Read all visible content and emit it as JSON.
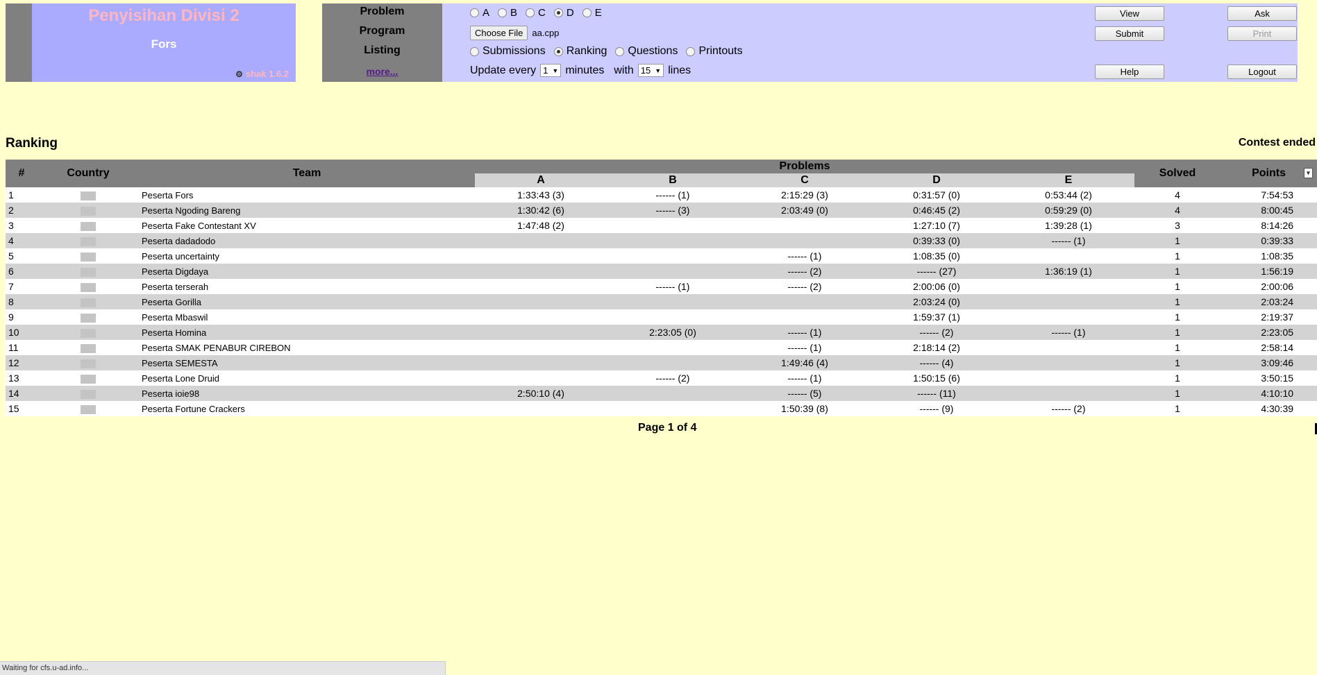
{
  "logo": {
    "title": "Penyisihan Divisi 2",
    "team": "Fors",
    "version_glyph": "⚙",
    "version": "shak 1.6.2"
  },
  "panel": {
    "labels": {
      "problem": "Problem",
      "program": "Program",
      "listing": "Listing",
      "more": "more..."
    },
    "problems": [
      {
        "label": "A",
        "selected": false
      },
      {
        "label": "B",
        "selected": false
      },
      {
        "label": "C",
        "selected": false
      },
      {
        "label": "D",
        "selected": true
      },
      {
        "label": "E",
        "selected": false
      }
    ],
    "choose_file": "Choose File",
    "file_name": "aa.cpp",
    "listings": [
      {
        "label": "Submissions",
        "selected": false
      },
      {
        "label": "Ranking",
        "selected": true
      },
      {
        "label": "Questions",
        "selected": false
      },
      {
        "label": "Printouts",
        "selected": false
      }
    ],
    "update": {
      "prefix": "Update every",
      "minutes_value": "1",
      "minutes_label": "minutes",
      "with_label": "with",
      "lines_value": "15",
      "lines_label": "lines"
    },
    "buttons": {
      "view": "View",
      "ask": "Ask",
      "submit": "Submit",
      "print": "Print",
      "help": "Help",
      "logout": "Logout"
    }
  },
  "ranking": {
    "title": "Ranking",
    "status": "Contest ended",
    "headers": {
      "rank": "#",
      "country": "Country",
      "team": "Team",
      "problems": "Problems",
      "solved": "Solved",
      "points": "Points"
    },
    "problem_cols": [
      "A",
      "B",
      "C",
      "D",
      "E"
    ],
    "rows": [
      {
        "rank": "1",
        "team": "Peserta Fors",
        "A": "1:33:43 (3)",
        "B": "------ (1)",
        "C": "2:15:29 (3)",
        "D": "0:31:57 (0)",
        "E": "0:53:44 (2)",
        "solved": "4",
        "points": "7:54:53"
      },
      {
        "rank": "2",
        "team": "Peserta Ngoding Bareng",
        "A": "1:30:42 (6)",
        "B": "------ (3)",
        "C": "2:03:49 (0)",
        "D": "0:46:45 (2)",
        "E": "0:59:29 (0)",
        "solved": "4",
        "points": "8:00:45"
      },
      {
        "rank": "3",
        "team": "Peserta Fake Contestant XV",
        "A": "1:47:48 (2)",
        "B": "",
        "C": "",
        "D": "1:27:10 (7)",
        "E": "1:39:28 (1)",
        "solved": "3",
        "points": "8:14:26"
      },
      {
        "rank": "4",
        "team": "Peserta dadadodo",
        "A": "",
        "B": "",
        "C": "",
        "D": "0:39:33 (0)",
        "E": "------ (1)",
        "solved": "1",
        "points": "0:39:33"
      },
      {
        "rank": "5",
        "team": "Peserta uncertainty",
        "A": "",
        "B": "",
        "C": "------ (1)",
        "D": "1:08:35 (0)",
        "E": "",
        "solved": "1",
        "points": "1:08:35"
      },
      {
        "rank": "6",
        "team": "Peserta Digdaya",
        "A": "",
        "B": "",
        "C": "------ (2)",
        "D": "------ (27)",
        "E": "1:36:19 (1)",
        "solved": "1",
        "points": "1:56:19"
      },
      {
        "rank": "7",
        "team": "Peserta terserah",
        "A": "",
        "B": "------ (1)",
        "C": "------ (2)",
        "D": "2:00:06 (0)",
        "E": "",
        "solved": "1",
        "points": "2:00:06"
      },
      {
        "rank": "8",
        "team": "Peserta Gorilla",
        "A": "",
        "B": "",
        "C": "",
        "D": "2:03:24 (0)",
        "E": "",
        "solved": "1",
        "points": "2:03:24"
      },
      {
        "rank": "9",
        "team": "Peserta Mbaswil",
        "A": "",
        "B": "",
        "C": "",
        "D": "1:59:37 (1)",
        "E": "",
        "solved": "1",
        "points": "2:19:37"
      },
      {
        "rank": "10",
        "team": "Peserta Homina",
        "A": "",
        "B": "2:23:05 (0)",
        "C": "------ (1)",
        "D": "------ (2)",
        "E": "------ (1)",
        "solved": "1",
        "points": "2:23:05"
      },
      {
        "rank": "11",
        "team": "Peserta SMAK PENABUR CIREBON",
        "A": "",
        "B": "",
        "C": "------ (1)",
        "D": "2:18:14 (2)",
        "E": "",
        "solved": "1",
        "points": "2:58:14"
      },
      {
        "rank": "12",
        "team": "Peserta SEMESTA",
        "A": "",
        "B": "",
        "C": "1:49:46 (4)",
        "D": "------ (4)",
        "E": "",
        "solved": "1",
        "points": "3:09:46"
      },
      {
        "rank": "13",
        "team": "Peserta Lone Druid",
        "A": "",
        "B": "------ (2)",
        "C": "------ (1)",
        "D": "1:50:15 (6)",
        "E": "",
        "solved": "1",
        "points": "3:50:15"
      },
      {
        "rank": "14",
        "team": "Peserta ioie98",
        "A": "2:50:10 (4)",
        "B": "",
        "C": "------ (5)",
        "D": "------ (11)",
        "E": "",
        "solved": "1",
        "points": "4:10:10"
      },
      {
        "rank": "15",
        "team": "Peserta Fortune Crackers",
        "A": "",
        "B": "",
        "C": "1:50:39 (8)",
        "D": "------ (9)",
        "E": "------ (2)",
        "solved": "1",
        "points": "4:30:39"
      }
    ],
    "pager": "Page 1 of 4"
  },
  "statusbar": {
    "text": "Waiting for cfs.u-ad.info..."
  }
}
